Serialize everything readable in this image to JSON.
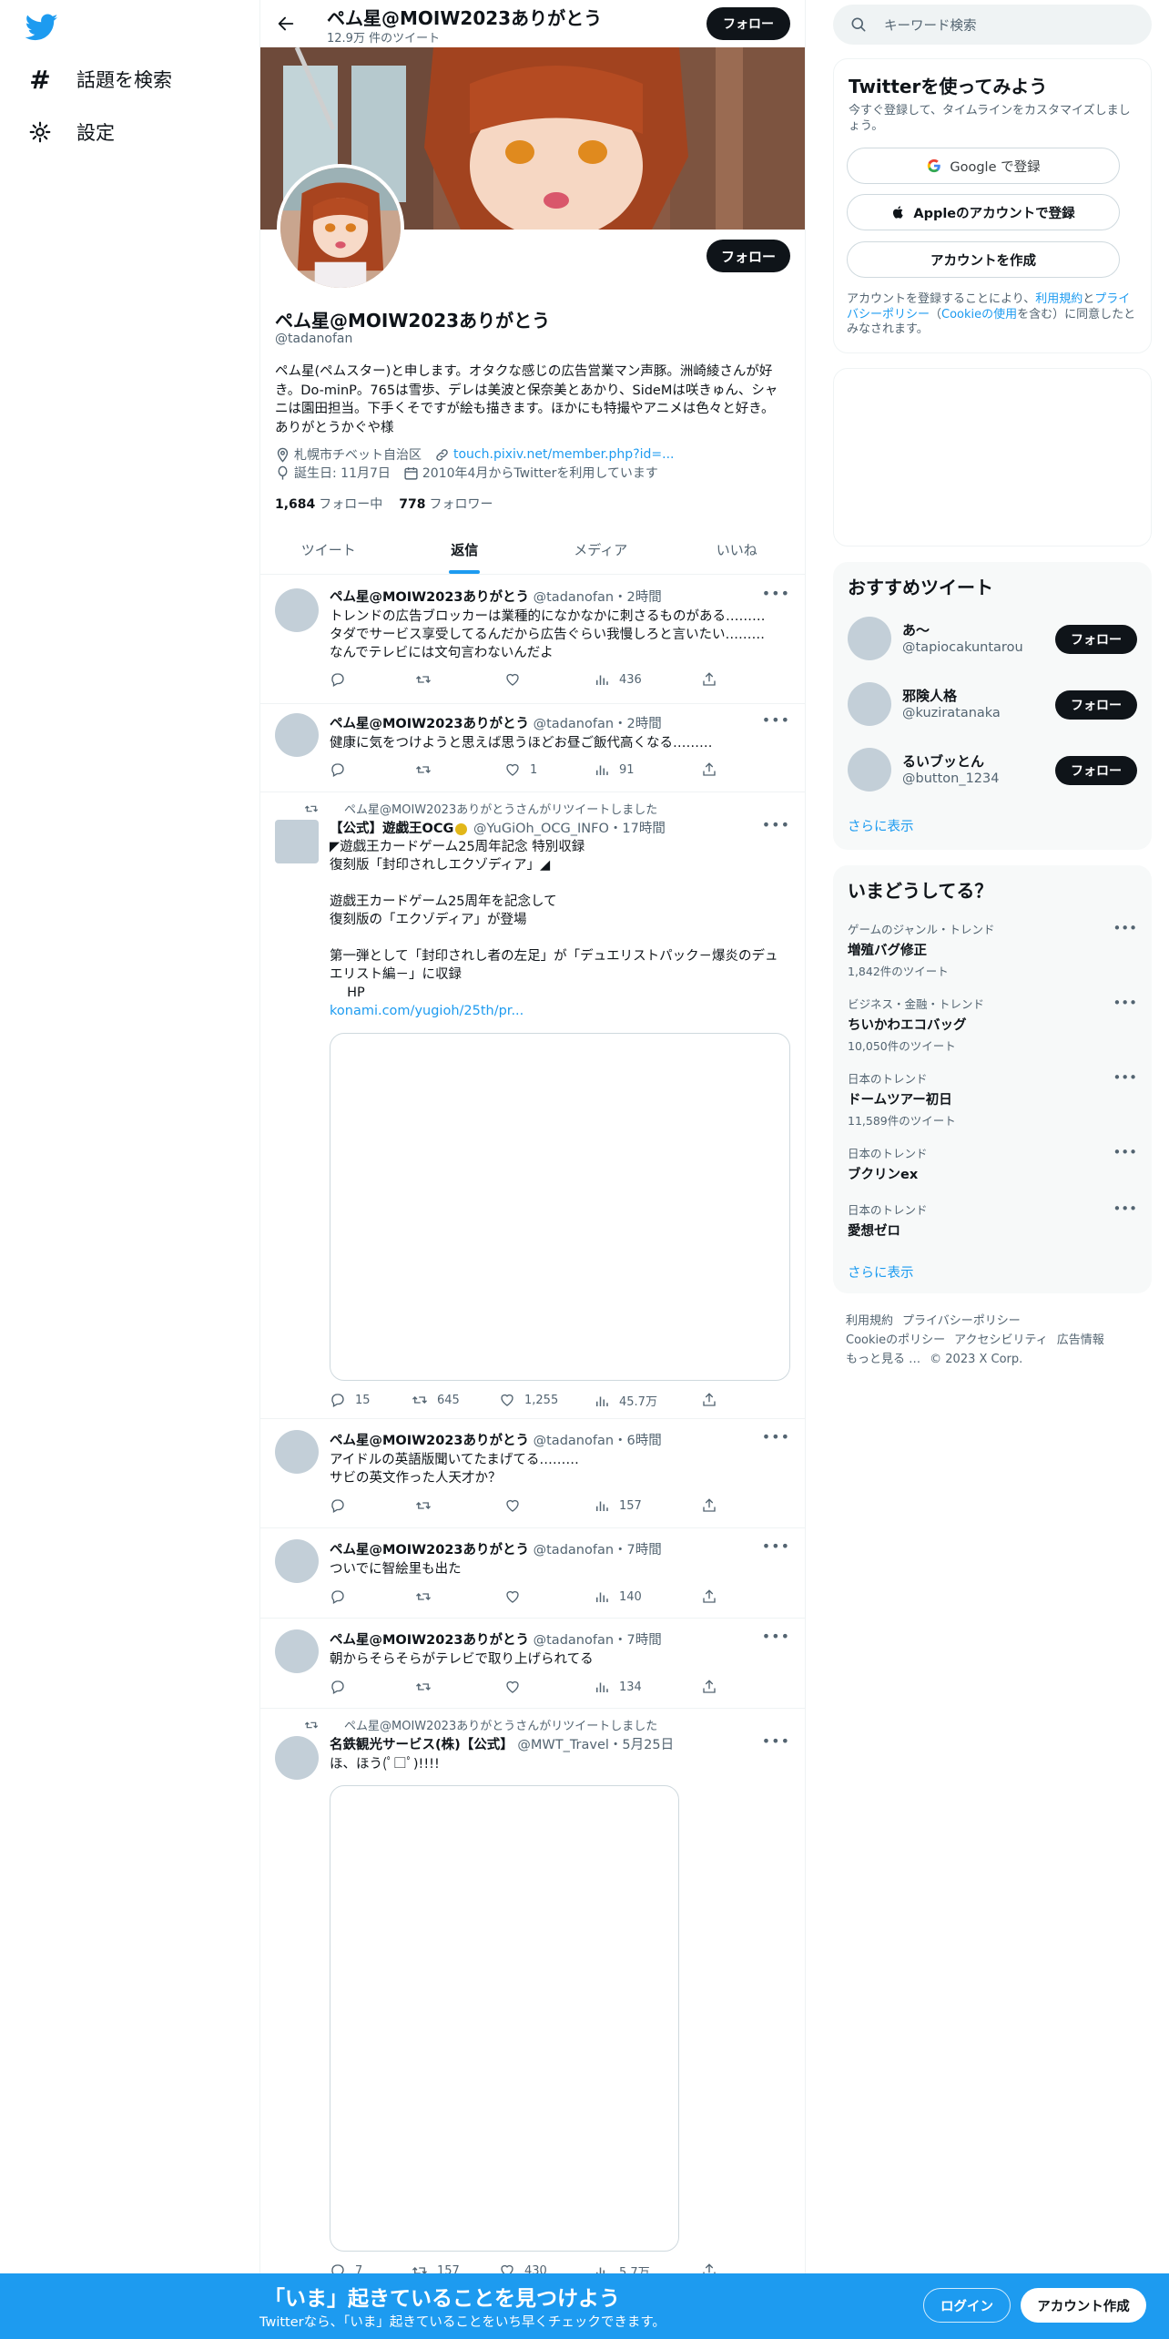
{
  "nav": {
    "explore_label": "話題を検索",
    "settings_label": "設定"
  },
  "header": {
    "name": "ペム星@MOIW2023ありがとう",
    "tweet_count": "12.9万 件のツイート",
    "follow_label": "フォロー"
  },
  "profile": {
    "name": "ペム星@MOIW2023ありがとう",
    "handle": "@tadanofan",
    "follow_label": "フォロー",
    "bio": "ペム星(ペムスター)と申します。オタクな感じの広告営業マン声豚。洲崎綾さんが好き。Do-minP。765は雪歩、デレは美波と保奈美とあかり、SideMは咲きゅん、シャニは園田担当。下手くそですが絵も描きます。ほかにも特撮やアニメは色々と好き。ありがとうかぐや様",
    "location": "札幌市チベット自治区",
    "link": "touch.pixiv.net/member.php?id=...",
    "birthday": "誕生日: 11月7日",
    "joined": "2010年4月からTwitterを利用しています",
    "following_count": "1,684",
    "following_label": "フォロー中",
    "followers_count": "778",
    "followers_label": "フォロワー"
  },
  "tabs": [
    "ツイート",
    "返信",
    "メディア",
    "いいね"
  ],
  "active_tab": "返信",
  "tweets": [
    {
      "name": "ペム星@MOIW2023ありがとう",
      "meta": "@tadanofan・2時間",
      "lines": [
        "トレンドの広告ブロッカーは業種的になかなかに刺さるものがある………",
        "タダでサービス享受してるんだから広告ぐらい我慢しろと言いたい………",
        "なんでテレビには文句言わないんだよ"
      ],
      "reply": "",
      "retweet": "",
      "like": "",
      "views": "436"
    },
    {
      "name": "ペム星@MOIW2023ありがとう",
      "meta": "@tadanofan・2時間",
      "lines": [
        "健康に気をつけようと思えば思うほどお昼ご飯代高くなる………"
      ],
      "reply": "",
      "retweet": "",
      "like": "1",
      "views": "91"
    },
    {
      "retweeted_by": "ペム星@MOIW2023ありがとうさんがリツイートしました",
      "name": "【公式】遊戯王OCG",
      "meta": "@YuGiOh_OCG_INFO・17時間",
      "lines": [
        "◤遊戯王カードゲーム25周年記念 特別収録",
        "復刻版「封印されしエクゾディア」◢",
        "",
        "遊戯王カードゲーム25周年を記念して",
        "復刻版の「エクゾディア」が登場",
        "",
        "第一弾として「封印されし者の左足」が「デュエリストパック－爆炎のデュエリスト編－」に収録",
        "　 HP"
      ],
      "link": "konami.com/yugioh/25th/pr...",
      "reply": "15",
      "retweet": "645",
      "like": "1,255",
      "views": "45.7万"
    },
    {
      "name": "ペム星@MOIW2023ありがとう",
      "meta": "@tadanofan・6時間",
      "lines": [
        "アイドルの英語版聞いてたまげてる………",
        "サビの英文作った人天才か？"
      ],
      "reply": "",
      "retweet": "",
      "like": "",
      "views": "157"
    },
    {
      "name": "ペム星@MOIW2023ありがとう",
      "meta": "@tadanofan・7時間",
      "lines": [
        "ついでに智絵里も出た"
      ],
      "reply": "",
      "retweet": "",
      "like": "",
      "views": "140"
    },
    {
      "name": "ペム星@MOIW2023ありがとう",
      "meta": "@tadanofan・7時間",
      "lines": [
        "朝からそらそらがテレビで取り上げられてる"
      ],
      "reply": "",
      "retweet": "",
      "like": "",
      "views": "134"
    },
    {
      "retweeted_by": "ペム星@MOIW2023ありがとうさんがリツイートしました",
      "name": "名鉄観光サービス(株)【公式】",
      "meta": "@MWT_Travel・5月25日",
      "lines": [
        "ほ、ほう(ﾟ□ﾟ)!!!!"
      ],
      "reply": "7",
      "retweet": "157",
      "like": "430",
      "views": "5.7万"
    }
  ],
  "right": {
    "search_placeholder": "キーワード検索",
    "signup": {
      "title": "Twitterを使ってみよう",
      "subtitle": "今すぐ登録して、タイムラインをカスタマイズしましょう。",
      "google": "Google で登録",
      "apple": "Appleのアカウントで登録",
      "create": "アカウントを作成",
      "terms_1": "アカウントを登録することにより、",
      "terms_link_1": "利用規約",
      "terms_2": "と",
      "terms_link_2": "プライバシーポリシー",
      "terms_3": "（",
      "terms_link_3": "Cookieの使用",
      "terms_4": "を含む）に同意したとみなされます。"
    },
    "recommend": {
      "title": "おすすめツイート",
      "users": [
        {
          "name": "あ〜",
          "handle": "@tapiocakuntarou"
        },
        {
          "name": "邪険人格",
          "handle": "@kuziratanaka"
        },
        {
          "name": "るいブッとん",
          "handle": "@button_1234"
        }
      ],
      "follow_label": "フォロー",
      "more": "さらに表示"
    },
    "trends": {
      "title": "いまどうしてる？",
      "items": [
        {
          "category": "ゲームのジャンル・トレンド",
          "name": "増殖バグ修正",
          "count": "1,842件のツイート"
        },
        {
          "category": "ビジネス・金融・トレンド",
          "name": "ちいかわエコバッグ",
          "count": "10,050件のツイート"
        },
        {
          "category": "日本のトレンド",
          "name": "ドームツアー初日",
          "count": "11,589件のツイート"
        },
        {
          "category": "日本のトレンド",
          "name": "ブクリンex",
          "count": ""
        },
        {
          "category": "日本のトレンド",
          "name": "愛想ゼロ",
          "count": ""
        }
      ],
      "more": "さらに表示"
    },
    "footer": {
      "terms": "利用規約",
      "privacy": "プライバシーポリシー",
      "cookie": "Cookieのポリシー",
      "accessibility": "アクセシビリティ",
      "ads": "広告情報",
      "more": "もっと見る …",
      "copyright": "© 2023 X Corp."
    }
  },
  "bottom_bar": {
    "title": "「いま」起きていることを見つけよう",
    "subtitle": "Twitterなら、「いま」起きていることをいち早くチェックできます。",
    "login": "ログイン",
    "signup": "アカウント作成"
  },
  "colors": {
    "accent": "#1d9bf0",
    "text": "#0f1419",
    "muted": "#536471",
    "button": "#0f1419"
  }
}
